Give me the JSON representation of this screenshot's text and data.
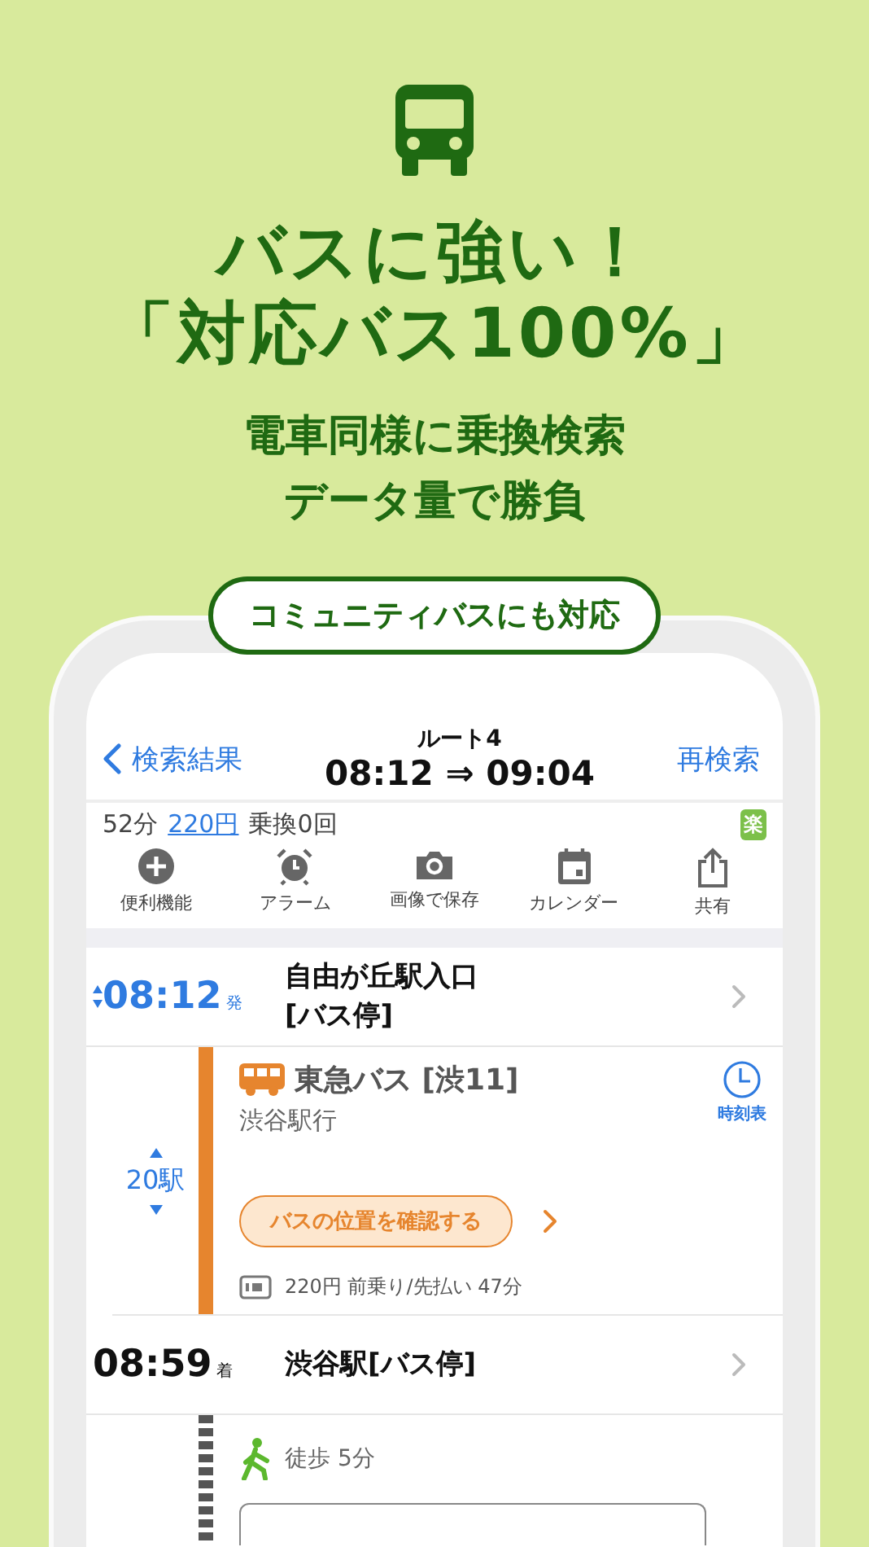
{
  "hero": {
    "headline": [
      "バスに強い！",
      "「対応バス100%」"
    ],
    "subtitle": [
      "電車同様に乗換検索",
      "データ量で勝負"
    ],
    "pill": "コミュニティバスにも対応"
  },
  "nav": {
    "back": "検索結果",
    "route": "ルート4",
    "times": "08:12 ⇒ 09:04",
    "action": "再検索"
  },
  "summary": {
    "duration": "52分",
    "fare": "220円",
    "transfers": "乗換0回",
    "badge": "楽"
  },
  "toolbar": [
    {
      "kind": "plus",
      "label": "便利機能"
    },
    {
      "kind": "alarm",
      "label": "アラーム"
    },
    {
      "kind": "camera",
      "label": "画像で保存"
    },
    {
      "kind": "calendar",
      "label": "カレンダー"
    },
    {
      "kind": "share",
      "label": "共有"
    }
  ],
  "legs": [
    {
      "kind": "departure",
      "time": "08:12",
      "suffix": "発",
      "name_lines": [
        "自由が丘駅入口",
        "[バス停]"
      ]
    },
    {
      "kind": "bus",
      "line": "東急バス [渋11]",
      "destination": "渋谷駅行",
      "stations": "20駅",
      "timetable": "時刻表",
      "button": "バスの位置を確認する",
      "fare": "220円 前乗り/先払い 47分"
    },
    {
      "kind": "arrival",
      "time": "08:59",
      "suffix": "着",
      "name_lines": [
        "渋谷駅[バス停]"
      ]
    },
    {
      "kind": "walk",
      "text": "徒歩 5分"
    }
  ]
}
